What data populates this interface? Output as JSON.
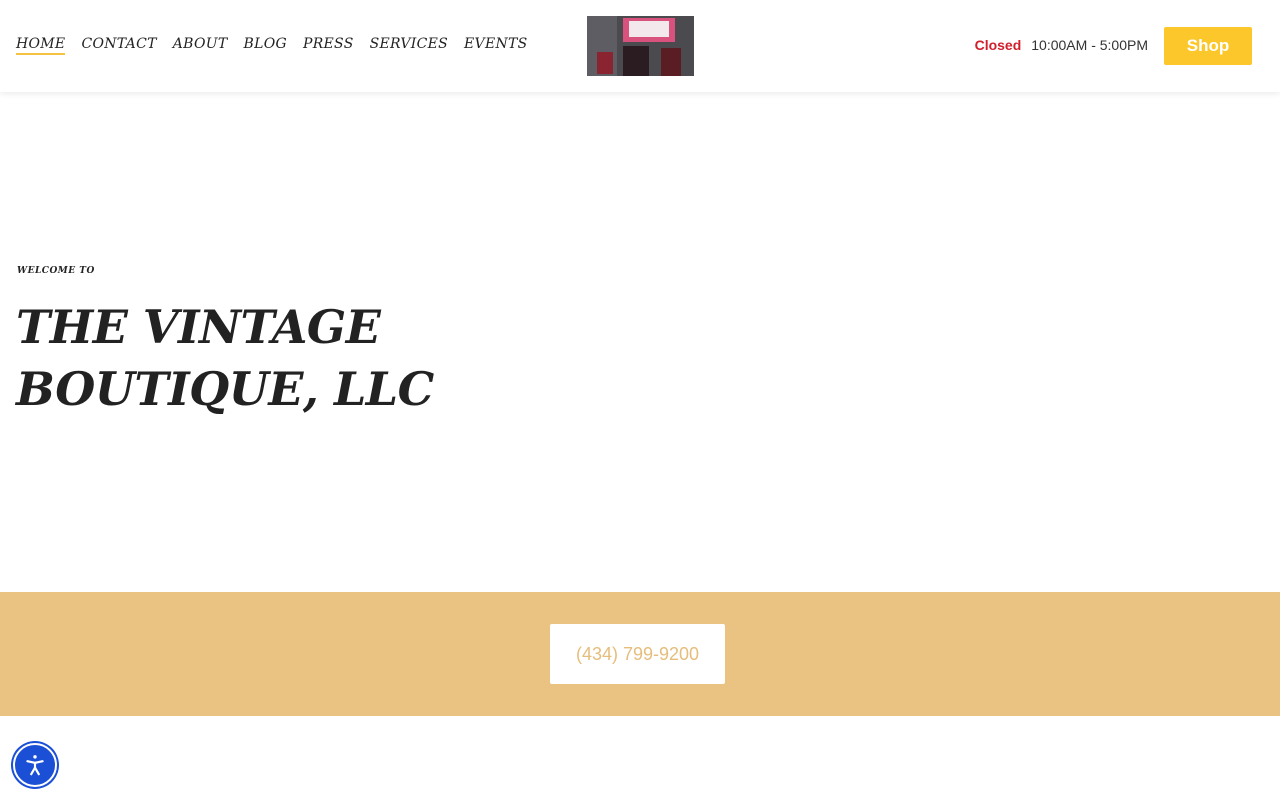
{
  "nav": {
    "items": [
      {
        "label": "HOME",
        "active": true
      },
      {
        "label": "CONTACT",
        "active": false
      },
      {
        "label": "ABOUT",
        "active": false
      },
      {
        "label": "BLOG",
        "active": false
      },
      {
        "label": "PRESS",
        "active": false
      },
      {
        "label": "SERVICES",
        "active": false
      },
      {
        "label": "EVENTS",
        "active": false
      }
    ]
  },
  "header": {
    "status": "Closed",
    "hours": "10:00AM - 5:00PM",
    "shop_label": "Shop",
    "logo_icon": "storefront-photo-icon"
  },
  "hero": {
    "eyebrow": "WELCOME TO",
    "title": "THE VINTAGE BOUTIQUE, LLC"
  },
  "band": {
    "phone": "(434) 799-9200"
  },
  "accessibility": {
    "icon": "accessibility-icon"
  },
  "colors": {
    "accent": "#fcc72b",
    "band": "#eac382",
    "closed": "#d11f2c",
    "a11y": "#1a4fd6"
  }
}
